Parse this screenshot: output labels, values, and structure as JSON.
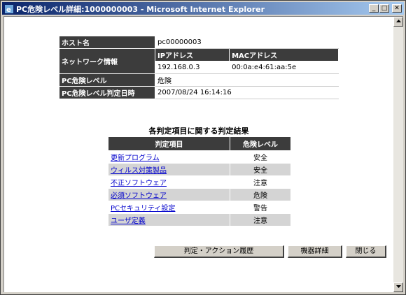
{
  "window": {
    "title": "PC危険レベル詳細:1000000003 - Microsoft Internet Explorer",
    "minimize": "_",
    "maximize": "□",
    "close": "✕"
  },
  "info": {
    "host_label": "ホスト名",
    "host_value": "pc00000003",
    "network_label": "ネットワーク情報",
    "ip_label": "IPアドレス",
    "mac_label": "MACアドレス",
    "ip_value": "192.168.0.3",
    "mac_value": "00:0a:e4:61:aa:5e",
    "risk_label": "PC危険レベル",
    "risk_value": "危険",
    "date_label": "PC危険レベル判定日時",
    "date_value": "2007/08/24 16:14:16"
  },
  "results": {
    "title": "各判定項目に関する判定結果",
    "col_item": "判定項目",
    "col_level": "危険レベル",
    "rows": [
      {
        "item": "更新プログラム",
        "level": "安全"
      },
      {
        "item": "ウィルス対策製品",
        "level": "安全"
      },
      {
        "item": "不正ソフトウェア",
        "level": "注意"
      },
      {
        "item": "必須ソフトウェア",
        "level": "危険"
      },
      {
        "item": "PCセキュリティ設定",
        "level": "警告"
      },
      {
        "item": "ユーザ定義",
        "level": "注意"
      }
    ]
  },
  "buttons": {
    "history": "判定・アクション履歴",
    "device": "機器詳細",
    "close": "閉じる"
  }
}
